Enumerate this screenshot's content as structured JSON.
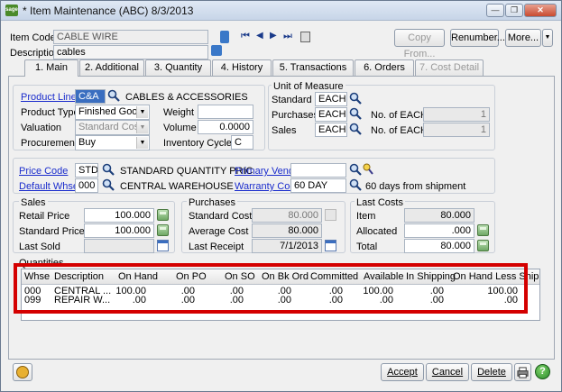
{
  "window": {
    "app_icon_text": "sage",
    "title": "* Item Maintenance (ABC) 8/3/2013",
    "minimize_label": "—",
    "restore_label": "❐",
    "close_label": "✕"
  },
  "header": {
    "item_code_label": "Item Code",
    "item_code_value": "CABLE WIRE",
    "description_label": "Description",
    "description_value": "cables",
    "copy_from_label": "Copy From...",
    "renumber_label": "Renumber...",
    "more_label": "More...",
    "more_arrow": "▼"
  },
  "nav_icons": {
    "first": "⏮",
    "prev": "◀",
    "next": "▶",
    "last": "⏭"
  },
  "tabs": [
    {
      "label": "1. Main"
    },
    {
      "label": "2. Additional"
    },
    {
      "label": "3. Quantity"
    },
    {
      "label": "4. History"
    },
    {
      "label": "5. Transactions"
    },
    {
      "label": "6. Orders"
    },
    {
      "label": "7. Cost Detail"
    }
  ],
  "main": {
    "product_line_label": "Product Line",
    "product_line_value": "C&A",
    "product_line_desc": "CABLES & ACCESSORIES",
    "product_type_label": "Product Type",
    "product_type_value": "Finished Good",
    "valuation_label": "Valuation",
    "valuation_value": "Standard Cost",
    "procurement_label": "Procurement",
    "procurement_value": "Buy",
    "weight_label": "Weight",
    "weight_value": "",
    "volume_label": "Volume",
    "volume_value": "0.0000",
    "inventory_cycle_label": "Inventory Cycle",
    "inventory_cycle_value": "C"
  },
  "uom": {
    "title": "Unit of Measure",
    "standard_label": "Standard",
    "standard_value": "EACH",
    "purchases_label": "Purchases",
    "purchases_value": "EACH",
    "sales_label": "Sales",
    "sales_value": "EACH",
    "no_of_each_1": "No. of  EACH",
    "no_of_each_1_value": "1",
    "no_of_each_2": "No. of  EACH",
    "no_of_each_2_value": "1"
  },
  "codes": {
    "price_code_label": "Price Code",
    "price_code_value": "STD",
    "price_code_desc": "STANDARD QUANTITY PRIC",
    "primary_vendor_label": "Primary Vendor",
    "primary_vendor_value": "",
    "default_whse_label": "Default Whse",
    "default_whse_value": "000",
    "default_whse_desc": "CENTRAL WAREHOUSE",
    "warranty_code_label": "Warranty Code",
    "warranty_code_value": "60 DAY",
    "warranty_desc": "60 days from shipment"
  },
  "sales": {
    "title": "Sales",
    "retail_price_label": "Retail Price",
    "retail_price_value": "100.000",
    "standard_price_label": "Standard Price",
    "standard_price_value": "100.000",
    "last_sold_label": "Last Sold",
    "last_sold_value": ""
  },
  "purchases": {
    "title": "Purchases",
    "standard_cost_label": "Standard Cost",
    "standard_cost_value": "80.000",
    "average_cost_label": "Average Cost",
    "average_cost_value": "80.000",
    "last_receipt_label": "Last Receipt",
    "last_receipt_value": "7/1/2013"
  },
  "last_costs": {
    "title": "Last Costs",
    "item_label": "Item",
    "item_value": "80.000",
    "allocated_label": "Allocated",
    "allocated_value": ".000",
    "total_label": "Total",
    "total_value": "80.000"
  },
  "quantities": {
    "title": "Quantities",
    "columns": [
      "Whse",
      "Description",
      "On Hand",
      "On PO",
      "On SO",
      "On Bk Ord",
      "Committed",
      "Available",
      "In Shipping",
      "On Hand Less Ship"
    ],
    "rows": [
      [
        "000",
        "CENTRAL ...",
        "100.00",
        ".00",
        ".00",
        ".00",
        ".00",
        "100.00",
        ".00",
        "100.00"
      ],
      [
        "099",
        "REPAIR W...",
        ".00",
        ".00",
        ".00",
        ".00",
        ".00",
        ".00",
        ".00",
        ".00"
      ]
    ]
  },
  "footer": {
    "accept_label": "Accept",
    "cancel_label": "Cancel",
    "delete_label": "Delete"
  },
  "colors": {
    "highlight_border": "#d40000",
    "link": "#1a2ccc"
  }
}
